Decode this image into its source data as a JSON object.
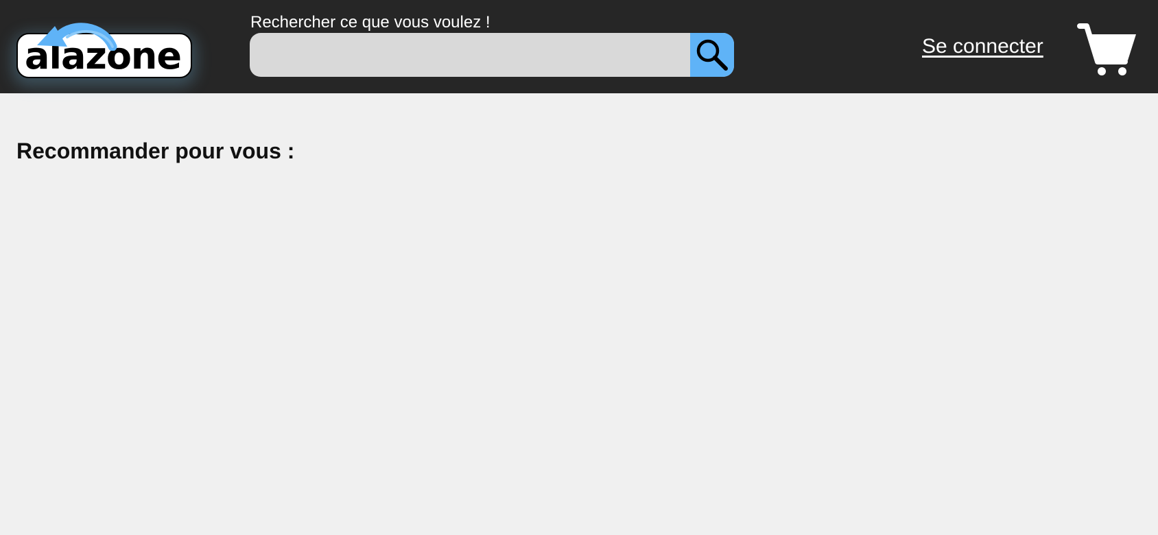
{
  "header": {
    "logo": {
      "text": "alazone",
      "icon": "curved-arrow-icon",
      "accent_color": "#5fb3f7"
    },
    "search": {
      "label": "Rechercher ce que vous voulez !",
      "value": "",
      "placeholder": "",
      "button_icon": "search-icon"
    },
    "login_label": "Se connecter",
    "cart_icon": "cart-icon"
  },
  "main": {
    "section_title": "Recommander pour vous :"
  },
  "colors": {
    "header_bg": "#262626",
    "page_bg": "#f0f0f0",
    "search_bg": "#d9d9d9",
    "accent": "#5fb3f7"
  }
}
